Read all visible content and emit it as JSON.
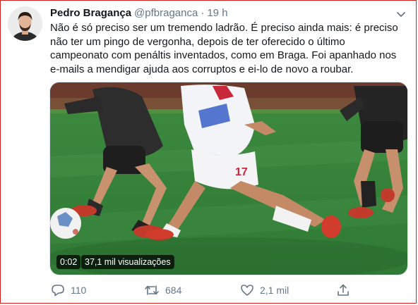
{
  "tweet": {
    "author_name": "Pedro Bragança",
    "author_handle": "@pfbraganca",
    "separator": "·",
    "time": "19 h",
    "text_lines": [
      "Não é só preciso ser um tremendo ladrão. É preciso ainda mais: é preciso",
      "não ter um pingo de vergonha, depois de ter oferecido o último",
      "campeonato com penáltis inventados, como em Braga. Foi apanhado nos",
      "e-mails a mendigar ajuda aos corruptos e ei-lo de novo a roubar."
    ]
  },
  "media": {
    "duration": "0:02",
    "views": "37,1 mil visualizações",
    "jersey_number": "17"
  },
  "actions": {
    "reply_count": "110",
    "retweet_count": "684",
    "like_count": "2,1 mil"
  },
  "icons": {
    "avatar": "avatar-photo",
    "caret": "chevron-down-icon",
    "reply": "comment-icon",
    "retweet": "retweet-icon",
    "like": "heart-icon",
    "share": "share-icon"
  },
  "colors": {
    "text_primary": "#14171a",
    "text_secondary": "#657786",
    "border": "#d21f1f"
  }
}
